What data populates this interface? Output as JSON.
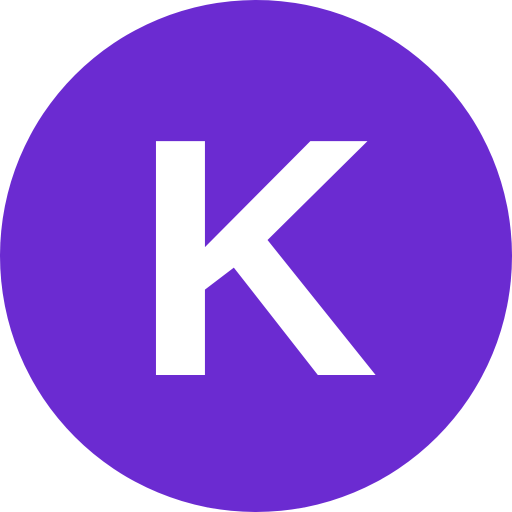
{
  "avatar": {
    "initial": "K",
    "background_color": "#6b2bd1",
    "text_color": "#ffffff"
  }
}
